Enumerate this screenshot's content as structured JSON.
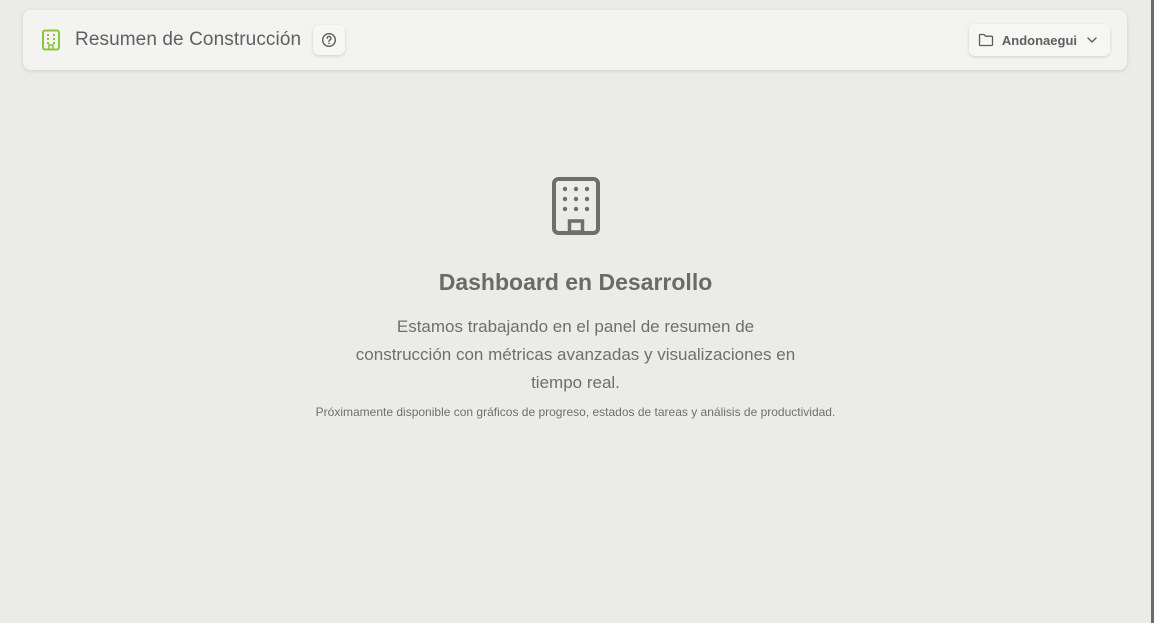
{
  "header": {
    "title": "Resumen de Construcción",
    "title_icon": "building-icon",
    "help_icon": "help-circle-icon",
    "accent_color": "#8cc63f"
  },
  "project_selector": {
    "icon": "folder-icon",
    "selected": "Andonaegui",
    "chevron_icon": "chevron-down-icon"
  },
  "placeholder": {
    "icon": "building-icon",
    "title": "Dashboard en Desarrollo",
    "description": "Estamos trabajando en el panel de resumen de construcción con métricas avanzadas y visualizaciones en tiempo real.",
    "note": "Próximamente disponible con gráficos de progreso, estados de tareas y análisis de productividad."
  }
}
